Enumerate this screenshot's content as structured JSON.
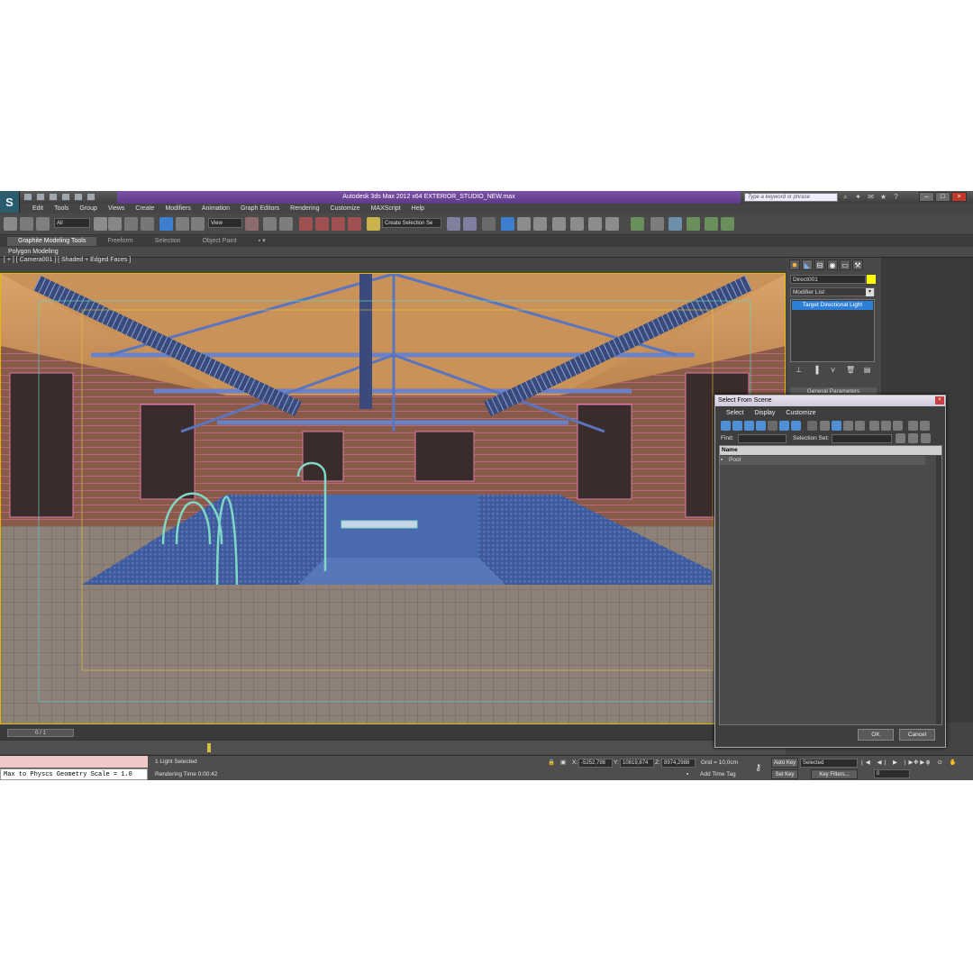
{
  "window": {
    "title": "Autodesk 3ds Max  2012 x64      EXTERIOR_STUDIO_NEW.max",
    "search_placeholder": "Type a keyword or phrase"
  },
  "menu": [
    "Edit",
    "Tools",
    "Group",
    "Views",
    "Create",
    "Modifiers",
    "Animation",
    "Graph Editors",
    "Rendering",
    "Customize",
    "MAXScript",
    "Help"
  ],
  "toolbar": {
    "selection_filter": "All",
    "reference_coord": "View",
    "named_selection": "Create Selection Se"
  },
  "ribbon": {
    "tabs": [
      "Graphite Modeling Tools",
      "Freeform",
      "Selection",
      "Object Paint"
    ],
    "panel_label": "Polygon Modeling"
  },
  "viewport": {
    "label": "[ + ] [ Camera001 ] [ Shaded + Edged Faces ]"
  },
  "timeline": {
    "frame_display": "0 / 1"
  },
  "command_panel": {
    "object_name": "Direct001",
    "modifier_list_label": "Modifier List",
    "stack_item": "Target Directional Light",
    "rollout_title": "General Parameters",
    "object_color": "#ffff00"
  },
  "dialog": {
    "title": "Select From Scene",
    "menu": [
      "Select",
      "Display",
      "Customize"
    ],
    "find_label": "Find:",
    "selection_set_label": "Selection Set:",
    "column_name": "Name",
    "rows": [
      "Pool"
    ],
    "ok_label": "OK",
    "cancel_label": "Cancel"
  },
  "status": {
    "script_output": "Max to Physcs Geometry Scale = 1.0",
    "selection_info": "1 Light Selected",
    "render_time": "Rendering Time  0:00:42",
    "x_label": "X:",
    "x": "-5252,798",
    "y_label": "Y:",
    "y": "10819,874",
    "z_label": "Z:",
    "z": "8974,2988",
    "grid": "Grid = 10,0cm",
    "add_time_tag": "Add Time Tag",
    "auto_key": "Auto Key",
    "set_key": "Set Key",
    "key_mode": "Selected",
    "key_filters": "Key Filters...",
    "frame": "0"
  },
  "colors": {
    "title_accent": "#6a45a0",
    "selection_blue": "#2e7fd8"
  }
}
